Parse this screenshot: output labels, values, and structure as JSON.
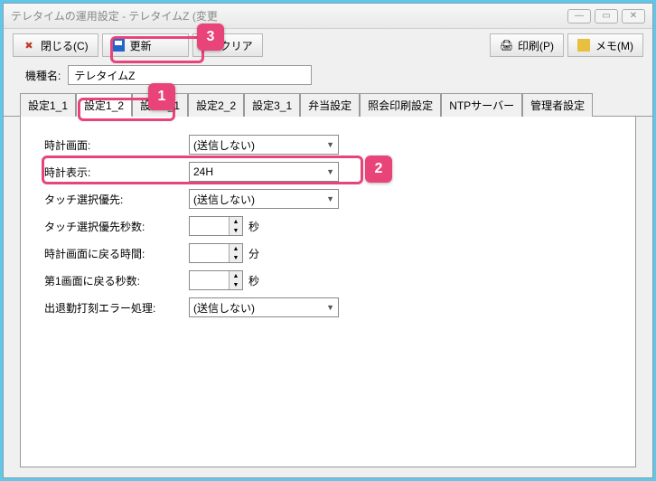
{
  "window": {
    "title": "テレタイムの運用設定 - テレタイムZ (変更"
  },
  "toolbar": {
    "close": "閉じる(C)",
    "update": "更新",
    "clear": "クリア",
    "print": "印刷(P)",
    "memo": "メモ(M)"
  },
  "model": {
    "label": "機種名:",
    "value": "テレタイムZ"
  },
  "tabs": [
    "設定1_1",
    "設定1_2",
    "設定2_1",
    "設定2_2",
    "設定3_1",
    "弁当設定",
    "照会印刷設定",
    "NTPサーバー",
    "管理者設定"
  ],
  "activeTab": "設定1_2",
  "form": {
    "clockScreen": {
      "label": "時計画面:",
      "value": "(送信しない)"
    },
    "clockDisplay": {
      "label": "時計表示:",
      "value": "24H"
    },
    "touchPriority": {
      "label": "タッチ選択優先:",
      "value": "(送信しない)"
    },
    "touchPrioritySec": {
      "label": "タッチ選択優先秒数:",
      "value": "",
      "unit": "秒"
    },
    "returnClockTime": {
      "label": "時計画面に戻る時間:",
      "value": "",
      "unit": "分"
    },
    "returnFirstSec": {
      "label": "第1画面に戻る秒数:",
      "value": "",
      "unit": "秒"
    },
    "punchError": {
      "label": "出退勤打刻エラー処理:",
      "value": "(送信しない)"
    }
  },
  "callouts": {
    "c1": "1",
    "c2": "2",
    "c3": "3"
  }
}
